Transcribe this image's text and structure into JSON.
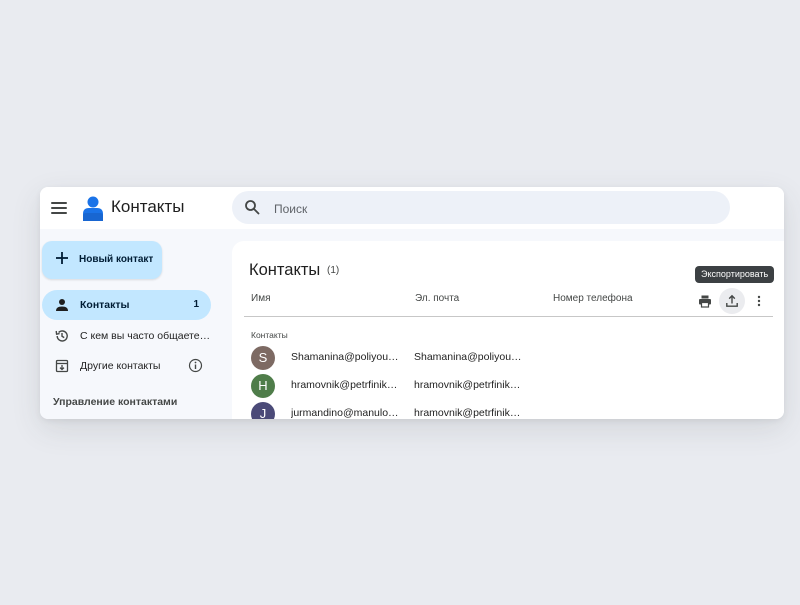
{
  "header": {
    "app_title": "Контакты",
    "search_placeholder": "Поиск"
  },
  "sidebar": {
    "new_contact_label": "Новый контакт",
    "items": [
      {
        "label": "Контакты",
        "count": "1",
        "icon": "person-icon",
        "active": true
      },
      {
        "label": "С кем вы часто общаете…",
        "icon": "history-icon"
      },
      {
        "label": "Другие контакты",
        "icon": "archive-download-icon",
        "extra_icon": "info-icon"
      }
    ],
    "section_title": "Управление контактами"
  },
  "main": {
    "title": "Контакты",
    "count": "(1)",
    "columns": [
      "Имя",
      "Эл. почта",
      "Номер телефона"
    ],
    "actions": [
      {
        "name": "print-icon"
      },
      {
        "name": "export-icon",
        "tooltip": "Экспортировать"
      },
      {
        "name": "more-vert-icon"
      }
    ],
    "group_label": "Контакты",
    "rows": [
      {
        "initial": "S",
        "avatar_color": "#7d6a63",
        "name": "Shamanina@poliyou…",
        "email": "Shamanina@poliyou…"
      },
      {
        "initial": "H",
        "avatar_color": "#4f7d4a",
        "name": "hramovnik@petrfinik…",
        "email": "hramovnik@petrfinik…"
      },
      {
        "initial": "J",
        "avatar_color": "#4b4a78",
        "name": "jurmandino@manulo…",
        "email": "hramovnik@petrfinik…"
      }
    ]
  },
  "colors": {
    "accent": "#c2e7ff",
    "page_background": "#e9ebf0",
    "surface": "#f6f8fc"
  }
}
